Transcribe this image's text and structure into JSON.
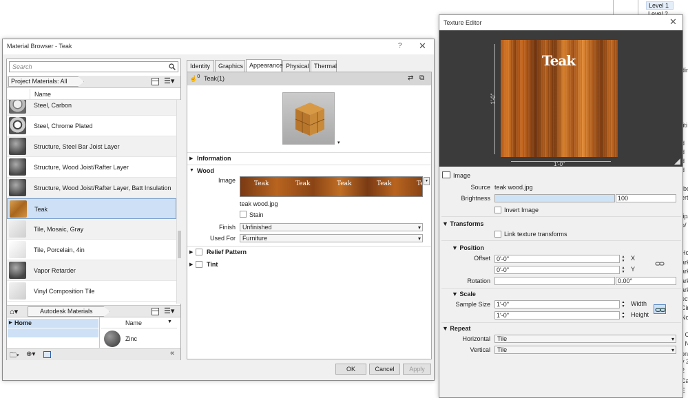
{
  "background": {
    "tree_level_1": "Level 1",
    "tree_level_2": "Level 2",
    "fragments": [
      "ding",
      "titi",
      "d",
      "d",
      "d",
      "d",
      "rbo",
      "erti",
      "tip/",
      "p/",
      "Hor",
      "ark",
      "ark",
      "ark",
      "ark",
      "ect",
      "Cir",
      "No",
      "- Ci",
      "- N",
      "ons",
      "y 2",
      "2",
      "Ca",
      "E"
    ]
  },
  "material_browser": {
    "title": "Material Browser - Teak",
    "help_label": "?",
    "close_label": "✕",
    "search_placeholder": "Search",
    "project_filter": "Project Materials: All",
    "column_name": "Name",
    "materials": [
      {
        "name": "Steel, Carbon",
        "thumb": "steel"
      },
      {
        "name": "Steel, Chrome Plated",
        "thumb": "chrome"
      },
      {
        "name": "Structure, Steel Bar Joist Layer",
        "thumb": "dark"
      },
      {
        "name": "Structure, Wood Joist/Rafter Layer",
        "thumb": "dark"
      },
      {
        "name": "Structure, Wood Joist/Rafter Layer, Batt Insulation",
        "thumb": "dark"
      },
      {
        "name": "Teak",
        "thumb": "teak",
        "selected": true
      },
      {
        "name": "Tile, Mosaic, Gray",
        "thumb": "light"
      },
      {
        "name": "Tile, Porcelain, 4in",
        "thumb": "white"
      },
      {
        "name": "Vapor Retarder",
        "thumb": "dark"
      },
      {
        "name": "Vinyl Composition Tile",
        "thumb": "light"
      }
    ],
    "library": {
      "name": "Autodesk Materials",
      "home_label": "Home",
      "column_name": "Name",
      "items": [
        {
          "name": "Zinc"
        }
      ]
    },
    "tabs": [
      "Identity",
      "Graphics",
      "Appearance",
      "Physical",
      "Thermal"
    ],
    "active_tab": "Appearance",
    "asset_name": "Teak(1)",
    "asset_users": "0",
    "sections": {
      "information": "Information",
      "wood": "Wood",
      "relief_pattern": "Relief  Pattern",
      "tint": "Tint"
    },
    "wood": {
      "image_label": "Image",
      "texture_word": "Teak",
      "texture_file": "teak wood.jpg",
      "stain_label": "Stain",
      "finish_label": "Finish",
      "finish_value": "Unfinished",
      "used_for_label": "Used For",
      "used_for_value": "Furniture"
    },
    "buttons": {
      "ok": "OK",
      "cancel": "Cancel",
      "apply": "Apply"
    }
  },
  "texture_editor": {
    "title": "Texture Editor",
    "close_label": "✕",
    "swatch_word": "Teak",
    "dim_height": "1'-0\"",
    "dim_width": "1'-0\"",
    "image_section": "Image",
    "source_label": "Source",
    "source_value": "teak wood.jpg",
    "brightness_label": "Brightness",
    "brightness_value": "100",
    "brightness_fraction": 1.0,
    "invert_label": "Invert Image",
    "transforms_section": "Transforms",
    "link_transforms_label": "Link texture transforms",
    "position_section": "Position",
    "offset_label": "Offset",
    "offset_x": "0'-0\"",
    "offset_y": "0'-0\"",
    "x_label": "X",
    "y_label": "Y",
    "rotation_label": "Rotation",
    "rotation_value": "0.00°",
    "scale_section": "Scale",
    "sample_size_label": "Sample Size",
    "width_value": "1'-0\"",
    "height_value": "1'-0\"",
    "width_label": "Width",
    "height_label": "Height",
    "repeat_section": "Repeat",
    "horizontal_label": "Horizontal",
    "horizontal_value": "Tile",
    "vertical_label": "Vertical",
    "vertical_value": "Tile"
  },
  "colors": {
    "selection": "#cde0f5",
    "selection_border": "#7da2ce",
    "canvas_bg": "#3b3b3b",
    "teak": "#c06e24"
  }
}
